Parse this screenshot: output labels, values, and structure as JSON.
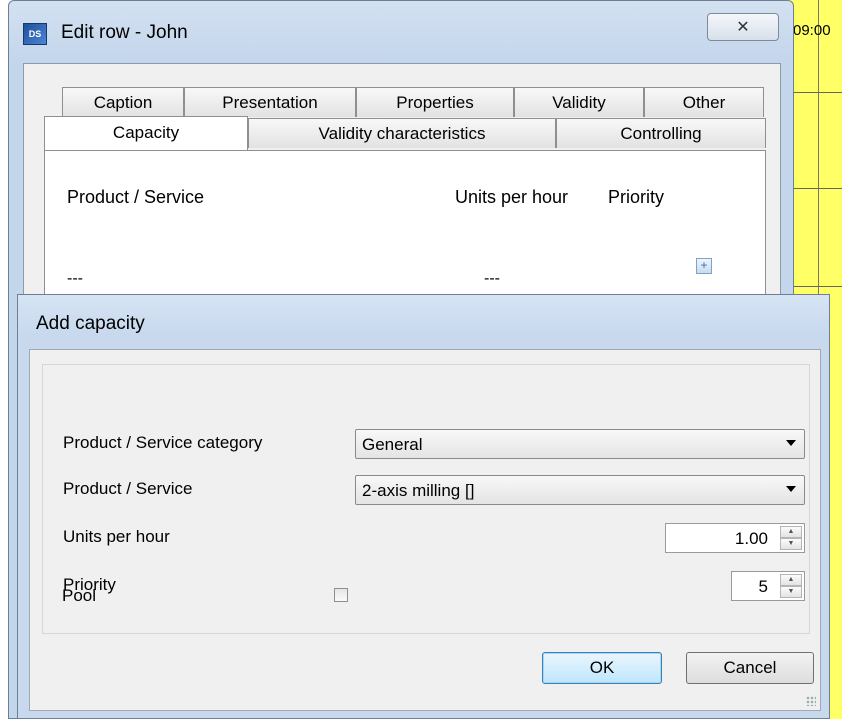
{
  "background": {
    "time_label": "09:00"
  },
  "edit_window": {
    "icon_text": "DS",
    "title": "Edit row - John",
    "close_glyph": "✕",
    "tabs_row1": [
      {
        "label": "Caption"
      },
      {
        "label": "Presentation"
      },
      {
        "label": "Properties"
      },
      {
        "label": "Validity"
      },
      {
        "label": "Other"
      }
    ],
    "tabs_row2": [
      {
        "label": "Capacity",
        "selected": true
      },
      {
        "label": "Validity characteristics"
      },
      {
        "label": "Controlling"
      }
    ],
    "capacity_table": {
      "headers": {
        "product": "Product / Service",
        "units": "Units per hour",
        "priority": "Priority"
      },
      "row": {
        "product": "---",
        "units": "---"
      },
      "add_icon": "plus-icon"
    }
  },
  "add_dialog": {
    "title": "Add capacity",
    "fields": {
      "category_label": "Product / Service category",
      "category_value": "General",
      "product_label": "Product / Service",
      "product_value": "2-axis milling []",
      "units_label": "Units per hour",
      "units_value": "1.00",
      "priority_label": "Priority",
      "priority_value": "5",
      "pool_label": "Pool",
      "pool_checked": false
    },
    "buttons": {
      "ok": "OK",
      "cancel": "Cancel"
    }
  },
  "colors": {
    "window_frame": "#c4d6ec",
    "background_grid": "#ffff66"
  }
}
